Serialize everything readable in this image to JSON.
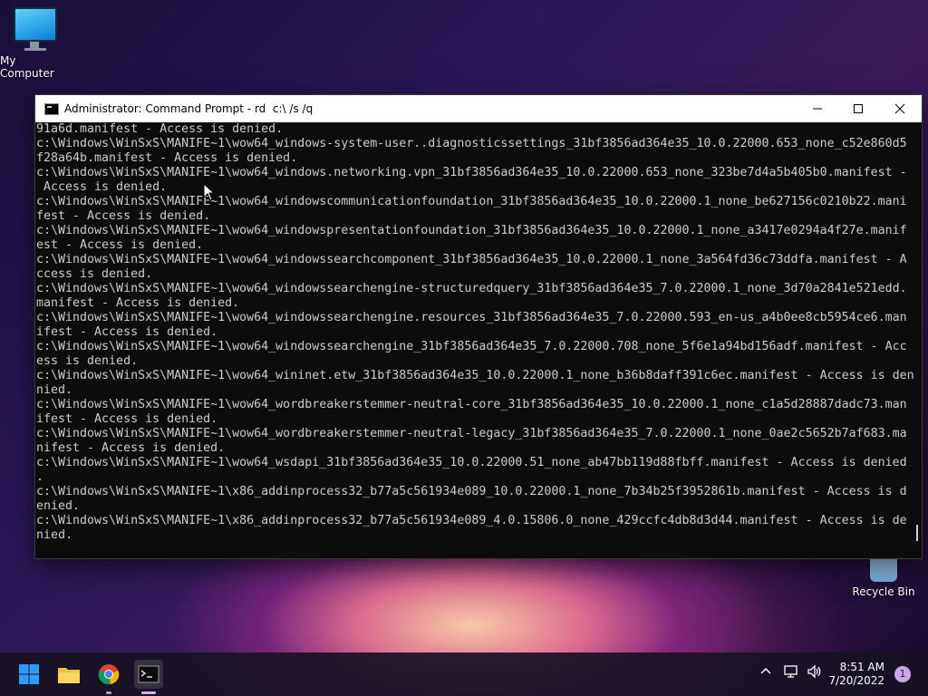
{
  "desktop": {
    "icons": [
      {
        "label": "My Computer"
      },
      {
        "label": "Recycle Bin"
      }
    ]
  },
  "window": {
    "title": "Administrator: Command Prompt - rd  c:\\ /s /q",
    "minimize_icon": "minimize-icon",
    "maximize_icon": "maximize-icon",
    "close_icon": "close-icon",
    "console_lines": [
      "91a6d.manifest - Access is denied.",
      "c:\\Windows\\WinSxS\\MANIFE~1\\wow64_windows-system-user..diagnosticssettings_31bf3856ad364e35_10.0.22000.653_none_c52e860d5",
      "f28a64b.manifest - Access is denied.",
      "c:\\Windows\\WinSxS\\MANIFE~1\\wow64_windows.networking.vpn_31bf3856ad364e35_10.0.22000.653_none_323be7d4a5b405b0.manifest -",
      " Access is denied.",
      "c:\\Windows\\WinSxS\\MANIFE~1\\wow64_windowscommunicationfoundation_31bf3856ad364e35_10.0.22000.1_none_be627156c0210b22.mani",
      "fest - Access is denied.",
      "c:\\Windows\\WinSxS\\MANIFE~1\\wow64_windowspresentationfoundation_31bf3856ad364e35_10.0.22000.1_none_a3417e0294a4f27e.manif",
      "est - Access is denied.",
      "c:\\Windows\\WinSxS\\MANIFE~1\\wow64_windowssearchcomponent_31bf3856ad364e35_10.0.22000.1_none_3a564fd36c73ddfa.manifest - A",
      "ccess is denied.",
      "c:\\Windows\\WinSxS\\MANIFE~1\\wow64_windowssearchengine-structuredquery_31bf3856ad364e35_7.0.22000.1_none_3d70a2841e521edd.",
      "manifest - Access is denied.",
      "c:\\Windows\\WinSxS\\MANIFE~1\\wow64_windowssearchengine.resources_31bf3856ad364e35_7.0.22000.593_en-us_a4b0ee8cb5954ce6.man",
      "ifest - Access is denied.",
      "c:\\Windows\\WinSxS\\MANIFE~1\\wow64_windowssearchengine_31bf3856ad364e35_7.0.22000.708_none_5f6e1a94bd156adf.manifest - Acc",
      "ess is denied.",
      "c:\\Windows\\WinSxS\\MANIFE~1\\wow64_wininet.etw_31bf3856ad364e35_10.0.22000.1_none_b36b8daff391c6ec.manifest - Access is deni",
      "nied.",
      "c:\\Windows\\WinSxS\\MANIFE~1\\wow64_wordbreakerstemmer-neutral-core_31bf3856ad364e35_10.0.22000.1_none_c1a5d28887dadc73.man",
      "ifest - Access is denied.",
      "c:\\Windows\\WinSxS\\MANIFE~1\\wow64_wordbreakerstemmer-neutral-legacy_31bf3856ad364e35_7.0.22000.1_none_0ae2c5652b7af683.ma",
      "nifest - Access is denied.",
      "c:\\Windows\\WinSxS\\MANIFE~1\\wow64_wsdapi_31bf3856ad364e35_10.0.22000.51_none_ab47bb119d88fbff.manifest - Access is denied",
      ".",
      "c:\\Windows\\WinSxS\\MANIFE~1\\x86_addinprocess32_b77a5c561934e089_10.0.22000.1_none_7b34b25f3952861b.manifest - Access is d",
      "enied.",
      "c:\\Windows\\WinSxS\\MANIFE~1\\x86_addinprocess32_b77a5c561934e089_4.0.15806.0_none_429ccfc4db8d3d44.manifest - Access is de",
      "nied."
    ]
  },
  "taskbar": {
    "apps": [
      {
        "icon": "windows-start-icon"
      },
      {
        "icon": "file-explorer-icon"
      },
      {
        "icon": "chrome-icon"
      },
      {
        "icon": "command-prompt-icon"
      }
    ],
    "tray": {
      "chevron_icon": "chevron-up-icon",
      "network_icon": "network-icon",
      "volume_icon": "volume-icon"
    },
    "clock": {
      "time": "8:51 AM",
      "date": "7/20/2022"
    },
    "notification_count": "1"
  }
}
